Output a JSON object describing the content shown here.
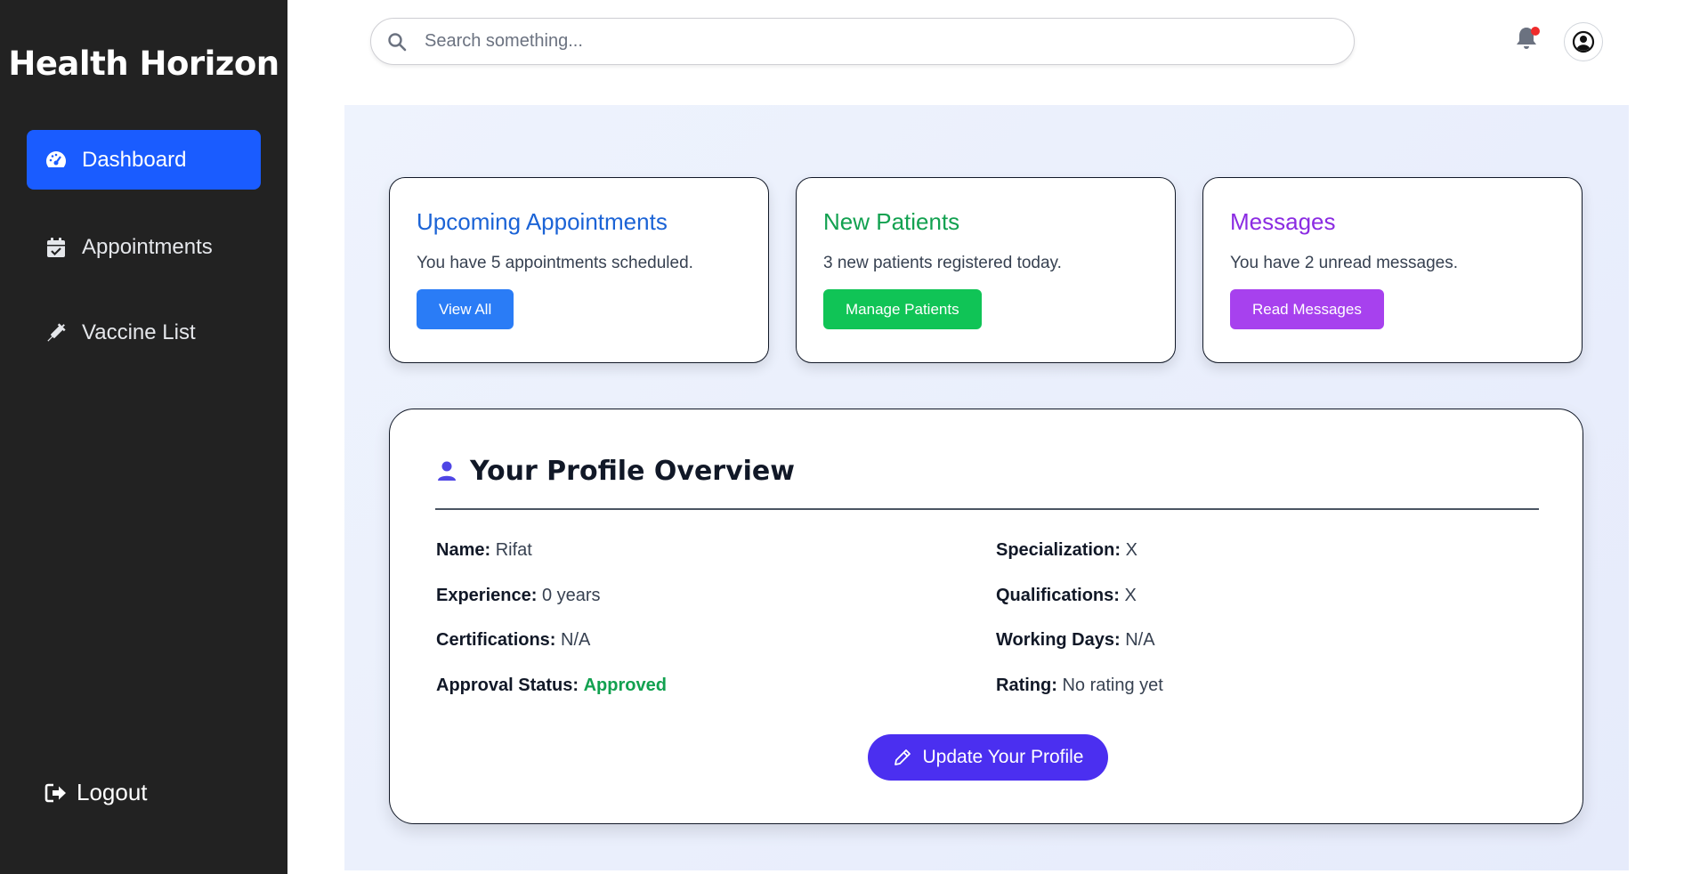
{
  "app": {
    "title": "Health Horizon"
  },
  "sidebar": {
    "items": [
      {
        "label": "Dashboard",
        "icon": "gauge-icon",
        "active": true
      },
      {
        "label": "Appointments",
        "icon": "calendar-check-icon",
        "active": false
      },
      {
        "label": "Vaccine List",
        "icon": "syringe-icon",
        "active": false
      }
    ],
    "logout_label": "Logout"
  },
  "header": {
    "search_placeholder": "Search something...",
    "notification_dot": true
  },
  "cards": [
    {
      "title": "Upcoming Appointments",
      "text": "You have 5 appointments scheduled.",
      "button": "View All",
      "color": "#1b63d6",
      "button_color": "#2a7cf6"
    },
    {
      "title": "New Patients",
      "text": "3 new patients registered today.",
      "button": "Manage Patients",
      "color": "#12a150",
      "button_color": "#10c456"
    },
    {
      "title": "Messages",
      "text": "You have 2 unread messages.",
      "button": "Read Messages",
      "color": "#8b2be2",
      "button_color": "#a741ee"
    }
  ],
  "profile": {
    "title": "Your Profile Overview",
    "fields": {
      "name": {
        "label": "Name:",
        "value": "Rifat"
      },
      "specialization": {
        "label": "Specialization:",
        "value": "X"
      },
      "experience": {
        "label": "Experience:",
        "value": "0 years"
      },
      "qualifications": {
        "label": "Qualifications:",
        "value": "X"
      },
      "certifications": {
        "label": "Certifications:",
        "value": "N/A"
      },
      "working_days": {
        "label": "Working Days:",
        "value": "N/A"
      },
      "approval_status": {
        "label": "Approval Status:",
        "value": "Approved"
      },
      "rating": {
        "label": "Rating:",
        "value": "No rating yet"
      }
    },
    "update_button": "Update Your Profile"
  },
  "colors": {
    "sidebar_bg": "#222222",
    "accent": "#1a5cff",
    "update_button": "#4b2ff0",
    "approved": "#12a150"
  }
}
